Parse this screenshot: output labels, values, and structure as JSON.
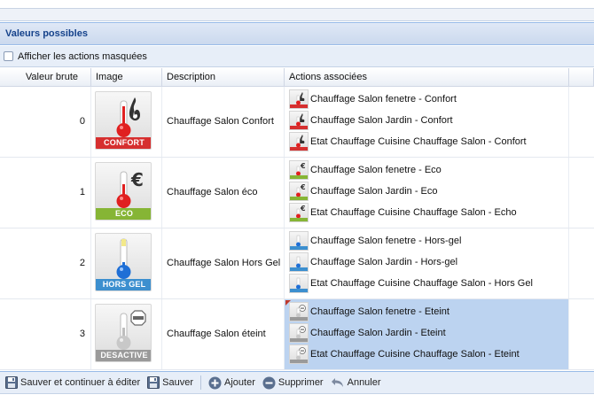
{
  "panel": {
    "title": "Valeurs possibles"
  },
  "toolbar_top": {
    "show_hidden_label": "Afficher les actions masquées"
  },
  "columns": {
    "value": "Valeur brute",
    "image": "Image",
    "description": "Description",
    "actions": "Actions associées"
  },
  "rows": [
    {
      "value": "0",
      "badge": "CONFORT",
      "badge_color": "#d62f2f",
      "icon": "flame-icon",
      "description": "Chauffage Salon Confort",
      "actions": [
        "Chauffage Salon fenetre - Confort",
        "Chauffage Salon Jardin - Confort",
        "Etat Chauffage Cuisine Chauffage Salon - Confort"
      ]
    },
    {
      "value": "1",
      "badge": "ECO",
      "badge_color": "#86b535",
      "icon": "euro-icon",
      "description": "Chauffage Salon éco",
      "actions": [
        "Chauffage Salon fenetre - Eco",
        "Chauffage Salon Jardin - Eco",
        "Etat Chauffage Cuisine Chauffage Salon - Echo"
      ]
    },
    {
      "value": "2",
      "badge": "HORS GEL",
      "badge_color": "#3c8fcf",
      "icon": "frost-icon",
      "description": "Chauffage Salon Hors Gel",
      "actions": [
        "Chauffage Salon fenetre - Hors-gel",
        "Chauffage Salon Jardin - Hors-gel",
        "Etat Chauffage Cuisine Chauffage Salon - Hors Gel"
      ]
    },
    {
      "value": "3",
      "badge": "DESACTIVE",
      "badge_color": "#9a9a9a",
      "icon": "stop-icon",
      "description": "Chauffage Salon éteint",
      "actions": [
        "Chauffage Salon fenetre - Eteint",
        "Chauffage Salon Jardin - Eteint",
        "Etat Chauffage Cuisine Chauffage Salon - Eteint"
      ]
    }
  ],
  "toolbar_bottom": {
    "save_continue": "Sauver et continuer à éditer",
    "save": "Sauver",
    "add": "Ajouter",
    "delete": "Supprimer",
    "cancel": "Annuler"
  },
  "colors": {
    "header_text": "#15428b",
    "selection": "#bcd3f0"
  }
}
